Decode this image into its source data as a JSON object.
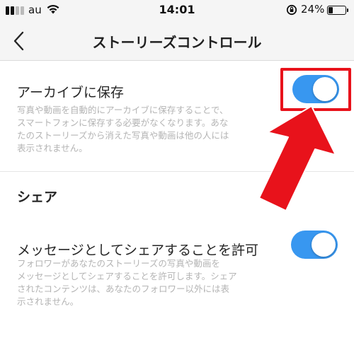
{
  "status_bar": {
    "carrier": "au",
    "time": "14:01",
    "battery_percent": "24%",
    "battery_level": 0.24,
    "icons": [
      "signal-bars-icon",
      "wifi-icon",
      "orientation-lock-icon",
      "battery-icon"
    ]
  },
  "nav": {
    "back_icon": "chevron-left-icon",
    "title": "ストーリーズコントロール"
  },
  "settings": {
    "archive": {
      "label": "アーカイブに保存",
      "description_lines": [
        "写真や動画を自動的にアーカイブに保存することで、",
        "スマートフォンに保存する必要がなくなります。あな",
        "たのストーリーズから消えた写真や動画は他の人には",
        "表示されません。"
      ],
      "enabled": true
    },
    "share_section": {
      "header": "シェア"
    },
    "allow_share": {
      "label": "メッセージとしてシェアすることを許可",
      "description_lines": [
        "フォロワーがあなたのストーリーズの写真や動画を",
        "メッセージとしてシェアすることを許可します。シェア",
        "されたコンテンツは、あなたのフォロワー以外には表",
        "示されません。"
      ],
      "enabled": true
    }
  },
  "colors": {
    "toggle_on": "#3897f0",
    "annotation_red": "#e8121b",
    "header_bg": "#f5f5f5",
    "description_gray": "#b4b4b4"
  },
  "annotation": {
    "type": "red-box-and-arrow",
    "target": "archive-toggle"
  }
}
